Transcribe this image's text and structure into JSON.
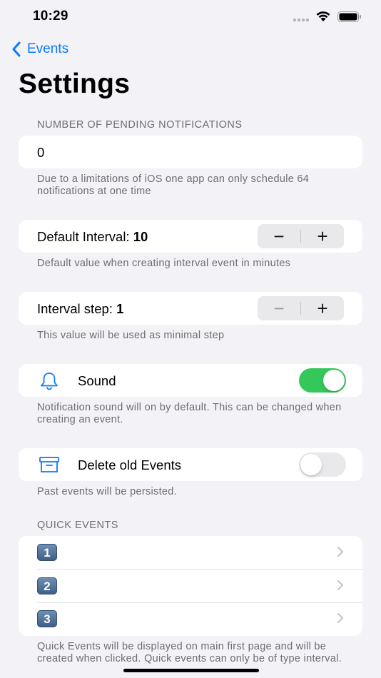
{
  "status_bar": {
    "time": "10:29"
  },
  "nav": {
    "back_label": "Events"
  },
  "page": {
    "title": "Settings"
  },
  "pending": {
    "header": "NUMBER OF PENDING NOTIFICATIONS",
    "value": "0",
    "footer": "Due to a limitations of iOS one app can only schedule 64 notifications at one time"
  },
  "default_interval": {
    "label": "Default Interval: ",
    "value": "10",
    "footer": "Default value when creating interval event in minutes",
    "minus": "−",
    "plus": "+"
  },
  "interval_step": {
    "label": "Interval step: ",
    "value": "1",
    "footer": "This value will be used as minimal step",
    "minus": "−",
    "plus": "+"
  },
  "sound": {
    "label": "Sound",
    "icon": "bell-icon",
    "enabled": true,
    "footer": "Notification sound will on by default. This can be changed when creating an event."
  },
  "delete_old": {
    "label": "Delete old Events",
    "icon": "archive-box-icon",
    "enabled": false,
    "footer": "Past events will be persisted."
  },
  "quick_events": {
    "header": "QUICK EVENTS",
    "items": [
      {
        "badge": "1"
      },
      {
        "badge": "2"
      },
      {
        "badge": "3"
      }
    ],
    "footer": "Quick Events will be displayed on main first page and will be created when clicked. Quick events can only be of type interval."
  },
  "colors": {
    "accent": "#0a7aff",
    "toggle_on": "#34c759",
    "background": "#f2f2f7"
  }
}
